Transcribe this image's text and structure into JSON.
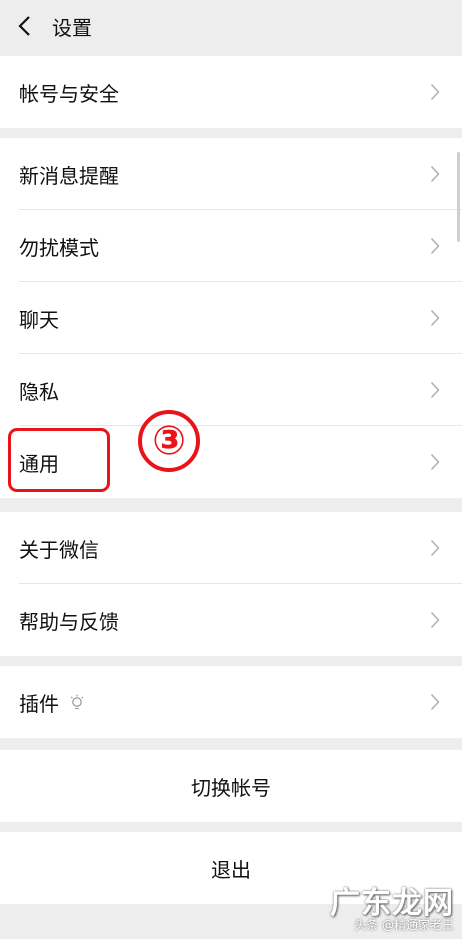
{
  "header": {
    "title": "设置"
  },
  "groups": {
    "account": [
      "帐号与安全"
    ],
    "main": [
      "新消息提醒",
      "勿扰模式",
      "聊天",
      "隐私",
      "通用"
    ],
    "about": [
      "关于微信",
      "帮助与反馈"
    ],
    "plugins": [
      "插件"
    ]
  },
  "actions": {
    "switch_account": "切换帐号",
    "logout": "退出"
  },
  "annotation": {
    "step": "③",
    "color": "#e8131b"
  },
  "watermark": {
    "brand": "广东龙网",
    "caption": "头条 @精通家老王"
  },
  "icons": {
    "back": "chevron-left-icon",
    "row_arrow": "chevron-right-icon",
    "plugin": "lightbulb-icon"
  }
}
